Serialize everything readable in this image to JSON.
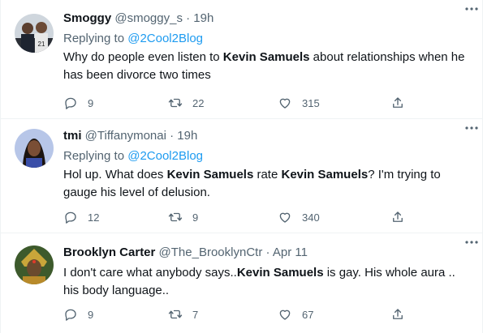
{
  "tweets": [
    {
      "name": "Smoggy",
      "handle": "@smoggy_s",
      "dot": "·",
      "time": "19h",
      "replying_prefix": "Replying to ",
      "replying_to": "@2Cool2Blog",
      "text_parts": [
        "Why do people even listen to ",
        "Kevin Samuels",
        " about relationships when he has been divorce two times"
      ],
      "replies": "9",
      "retweets": "22",
      "likes": "315"
    },
    {
      "name": "tmi",
      "handle": "@Tiffanymonai",
      "dot": "·",
      "time": "19h",
      "replying_prefix": "Replying to ",
      "replying_to": "@2Cool2Blog",
      "text_parts": [
        "Hol up. What does ",
        "Kevin Samuels",
        " rate ",
        "Kevin Samuels",
        "? I'm trying to gauge his level of delusion."
      ],
      "replies": "12",
      "retweets": "9",
      "likes": "340"
    },
    {
      "name": "Brooklyn Carter",
      "handle": "@The_BrooklynCtr",
      "dot": "·",
      "time": "Apr 11",
      "text_parts": [
        "I don't care what anybody says..",
        "Kevin Samuels",
        " is gay. His whole aura .. his body language.."
      ],
      "replies": "9",
      "retweets": "7",
      "likes": "67"
    }
  ],
  "icons": {
    "more": "more-horizontal-icon",
    "reply": "reply-bubble-icon",
    "retweet": "retweet-icon",
    "like": "heart-icon",
    "share": "share-icon"
  },
  "colors": {
    "text": "#0f1419",
    "secondary": "#536471",
    "link": "#1d9bf0",
    "divider": "#eff3f4"
  }
}
